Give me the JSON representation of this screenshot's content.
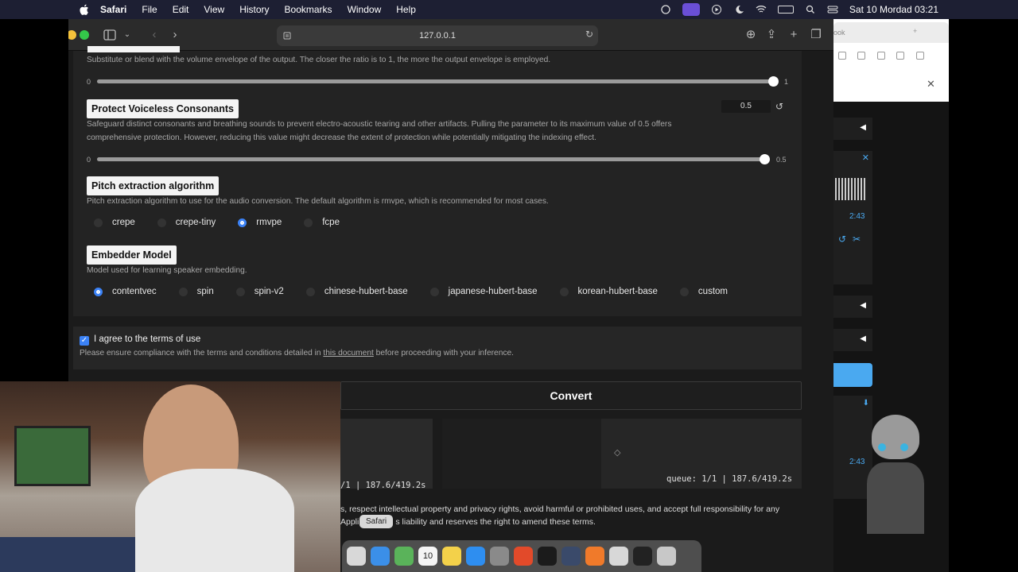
{
  "menubar": {
    "app_name": "Safari",
    "items": [
      "File",
      "Edit",
      "View",
      "History",
      "Bookmarks",
      "Window",
      "Help"
    ],
    "datetime": "Sat 10 Mordad  03:21"
  },
  "browser": {
    "url": "127.0.0.1"
  },
  "volume_envelope": {
    "description": "Substitute or blend with the volume envelope of the output. The closer the ratio is to 1, the more the output envelope is employed.",
    "min_label": "0",
    "max_label": "1",
    "value": 1.0
  },
  "protect": {
    "label": "Protect Voiceless Consonants",
    "value": "0.5",
    "description": "Safeguard distinct consonants and breathing sounds to prevent electro-acoustic tearing and other artifacts. Pulling the parameter to its maximum value of 0.5 offers comprehensive protection. However, reducing this value might decrease the extent of protection while potentially mitigating the indexing effect.",
    "min_label": "0",
    "max_label": "0.5",
    "fraction": 1.0
  },
  "pitch": {
    "label": "Pitch extraction algorithm",
    "description": "Pitch extraction algorithm to use for the audio conversion. The default algorithm is rmvpe, which is recommended for most cases.",
    "options": [
      "crepe",
      "crepe-tiny",
      "rmvpe",
      "fcpe"
    ],
    "selected": "rmvpe"
  },
  "embedder": {
    "label": "Embedder Model",
    "description": "Model used for learning speaker embedding.",
    "options": [
      "contentvec",
      "spin",
      "spin-v2",
      "chinese-hubert-base",
      "japanese-hubert-base",
      "korean-hubert-base",
      "custom"
    ],
    "selected": "contentvec"
  },
  "terms": {
    "checkbox_label": "I agree to the terms of use",
    "text_before": "Please ensure compliance with the terms and conditions detailed in",
    "link_text": "this document",
    "text_after": "before proceeding with your inference."
  },
  "convert_label": "Convert",
  "queue_left": "/1 | 187.6/419.2s",
  "queue_right": "queue: 1/1 | 187.6/419.2s",
  "footer": {
    "line1": "s, respect intellectual property and privacy rights, avoid harmful or prohibited uses, and accept full responsibility for any",
    "line2_a": "Appli",
    "line2_b": "s liability and reserves the right to amend these terms."
  },
  "dock_tooltip": "Safari",
  "side_panel": {
    "tab_label": "ook",
    "time_1": "2:43",
    "time_2": "2:43"
  }
}
